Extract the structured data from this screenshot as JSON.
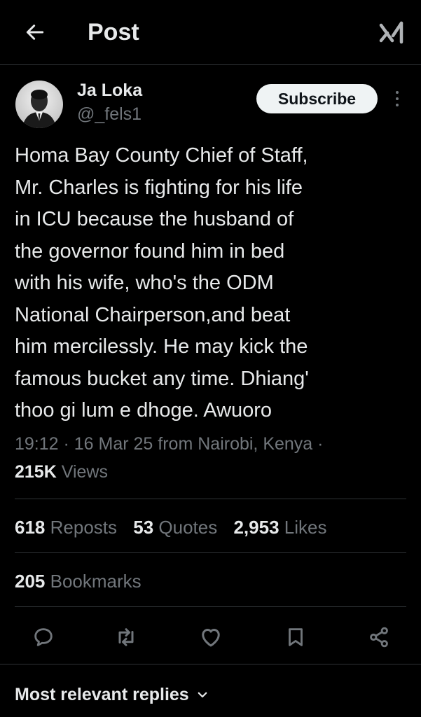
{
  "header": {
    "title": "Post",
    "back_icon": "arrow-left-icon",
    "grok_icon": "grok-icon"
  },
  "author": {
    "name": "Ja Loka",
    "handle": "@_fels1",
    "subscribe_label": "Subscribe",
    "more_icon": "more-vertical-icon"
  },
  "post": {
    "lines": [
      "Homa Bay County Chief of Staff,",
      "Mr. Charles is fighting for his life",
      "in ICU because the husband of",
      "the governor found him in bed",
      "with his wife, who's the ODM",
      "National Chairperson,and beat",
      "him mercilessly. He may kick the",
      "famous bucket any time. Dhiang'",
      "thoo gi lum e dhoge. Awuoro"
    ],
    "meta": "19:12 · 16 Mar 25 from Nairobi, Kenya ·",
    "views_count": "215K",
    "views_label": "Views"
  },
  "stats": {
    "reposts_count": "618",
    "reposts_label": "Reposts",
    "quotes_count": "53",
    "quotes_label": "Quotes",
    "likes_count": "2,953",
    "likes_label": "Likes",
    "bookmarks_count": "205",
    "bookmarks_label": "Bookmarks"
  },
  "actions": {
    "reply_icon": "reply-icon",
    "repost_icon": "repost-icon",
    "like_icon": "heart-icon",
    "bookmark_icon": "bookmark-icon",
    "share_icon": "share-icon"
  },
  "replies": {
    "sort_label": "Most relevant replies",
    "chevron_icon": "chevron-down-icon"
  },
  "colors": {
    "background": "#000000",
    "text_primary": "#e7e9ea",
    "text_secondary": "#71767b",
    "divider": "#2f3336",
    "button_bg": "#eff3f4"
  }
}
